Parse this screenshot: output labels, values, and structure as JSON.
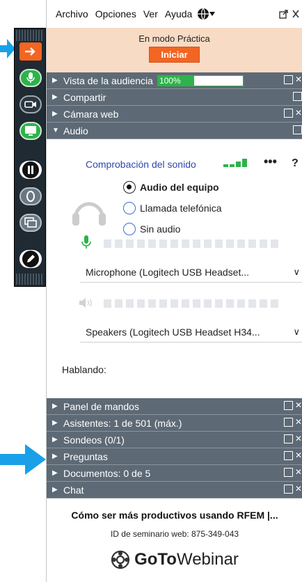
{
  "menu": {
    "items": [
      "Archivo",
      "Opciones",
      "Ver",
      "Ayuda"
    ]
  },
  "practice": {
    "message": "En modo Práctica",
    "start_label": "Iniciar"
  },
  "sections_top": [
    {
      "label": "Vista de la audiencia",
      "expanded": false
    },
    {
      "label": "Compartir",
      "expanded": false
    },
    {
      "label": "Cámara web",
      "expanded": false
    },
    {
      "label": "Audio",
      "expanded": true
    }
  ],
  "audience_view": {
    "zoom": "100%",
    "zoom_fraction": 1.0
  },
  "audio": {
    "sound_check": "Comprobación del sonido",
    "more": "•••",
    "help": "?",
    "options": [
      "Audio del equipo",
      "Llamada telefónica",
      "Sin audio"
    ],
    "selected_option": "Audio del equipo",
    "microphone": "Microphone (Logitech USB Headset...",
    "speakers": "Speakers (Logitech USB Headset H34...",
    "speaking_label": "Hablando:"
  },
  "sections_bottom": [
    {
      "label": "Panel de mandos"
    },
    {
      "label": "Asistentes: 1 de 501 (máx.)"
    },
    {
      "label": "Sondeos (0/1)"
    },
    {
      "label": "Preguntas"
    },
    {
      "label": "Documentos: 0 de 5"
    },
    {
      "label": "Chat"
    }
  ],
  "footer": {
    "title": "Cómo ser más productivos usando RFEM |...",
    "webinar_id": "ID de seminario web: 875-349-043",
    "logo_goto": "GoTo",
    "logo_webinar": "Webinar"
  },
  "colors": {
    "accent_orange": "#f26522",
    "practice_bg": "#f8dbc4",
    "section_bg": "#5d6a76",
    "green": "#2db34a",
    "link_blue": "#3046b0"
  }
}
